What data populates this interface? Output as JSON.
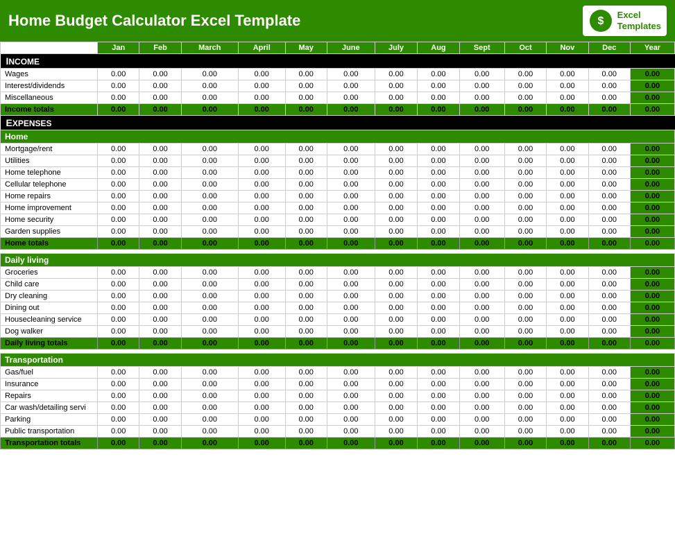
{
  "header": {
    "title": "Home Budget Calculator Excel Template",
    "logo_line1": "Excel",
    "logo_line2": "Templates"
  },
  "columns": {
    "label": "",
    "months": [
      "Jan",
      "Feb",
      "March",
      "April",
      "May",
      "June",
      "July",
      "Aug",
      "Sept",
      "Oct",
      "Nov",
      "Dec"
    ],
    "year": "Year"
  },
  "income": {
    "section_label": "Income",
    "rows": [
      {
        "label": "Wages"
      },
      {
        "label": "Interest/dividends"
      },
      {
        "label": "Miscellaneous"
      }
    ],
    "totals_label": "Income totals"
  },
  "expenses": {
    "section_label": "Expenses",
    "subsections": [
      {
        "name": "Home",
        "rows": [
          {
            "label": "Mortgage/rent"
          },
          {
            "label": "Utilities"
          },
          {
            "label": "Home telephone"
          },
          {
            "label": "Cellular telephone"
          },
          {
            "label": "Home repairs"
          },
          {
            "label": "Home improvement"
          },
          {
            "label": "Home security"
          },
          {
            "label": "Garden supplies"
          }
        ],
        "totals_label": "Home totals"
      },
      {
        "name": "Daily living",
        "rows": [
          {
            "label": "Groceries"
          },
          {
            "label": "Child care"
          },
          {
            "label": "Dry cleaning"
          },
          {
            "label": "Dining out"
          },
          {
            "label": "Housecleaning service"
          },
          {
            "label": "Dog walker"
          }
        ],
        "totals_label": "Daily living totals"
      },
      {
        "name": "Transportation",
        "rows": [
          {
            "label": "Gas/fuel"
          },
          {
            "label": "Insurance"
          },
          {
            "label": "Repairs"
          },
          {
            "label": "Car wash/detailing servi"
          },
          {
            "label": "Parking"
          },
          {
            "label": "Public transportation"
          }
        ],
        "totals_label": "Transportation totals"
      }
    ]
  },
  "zero": "0.00"
}
